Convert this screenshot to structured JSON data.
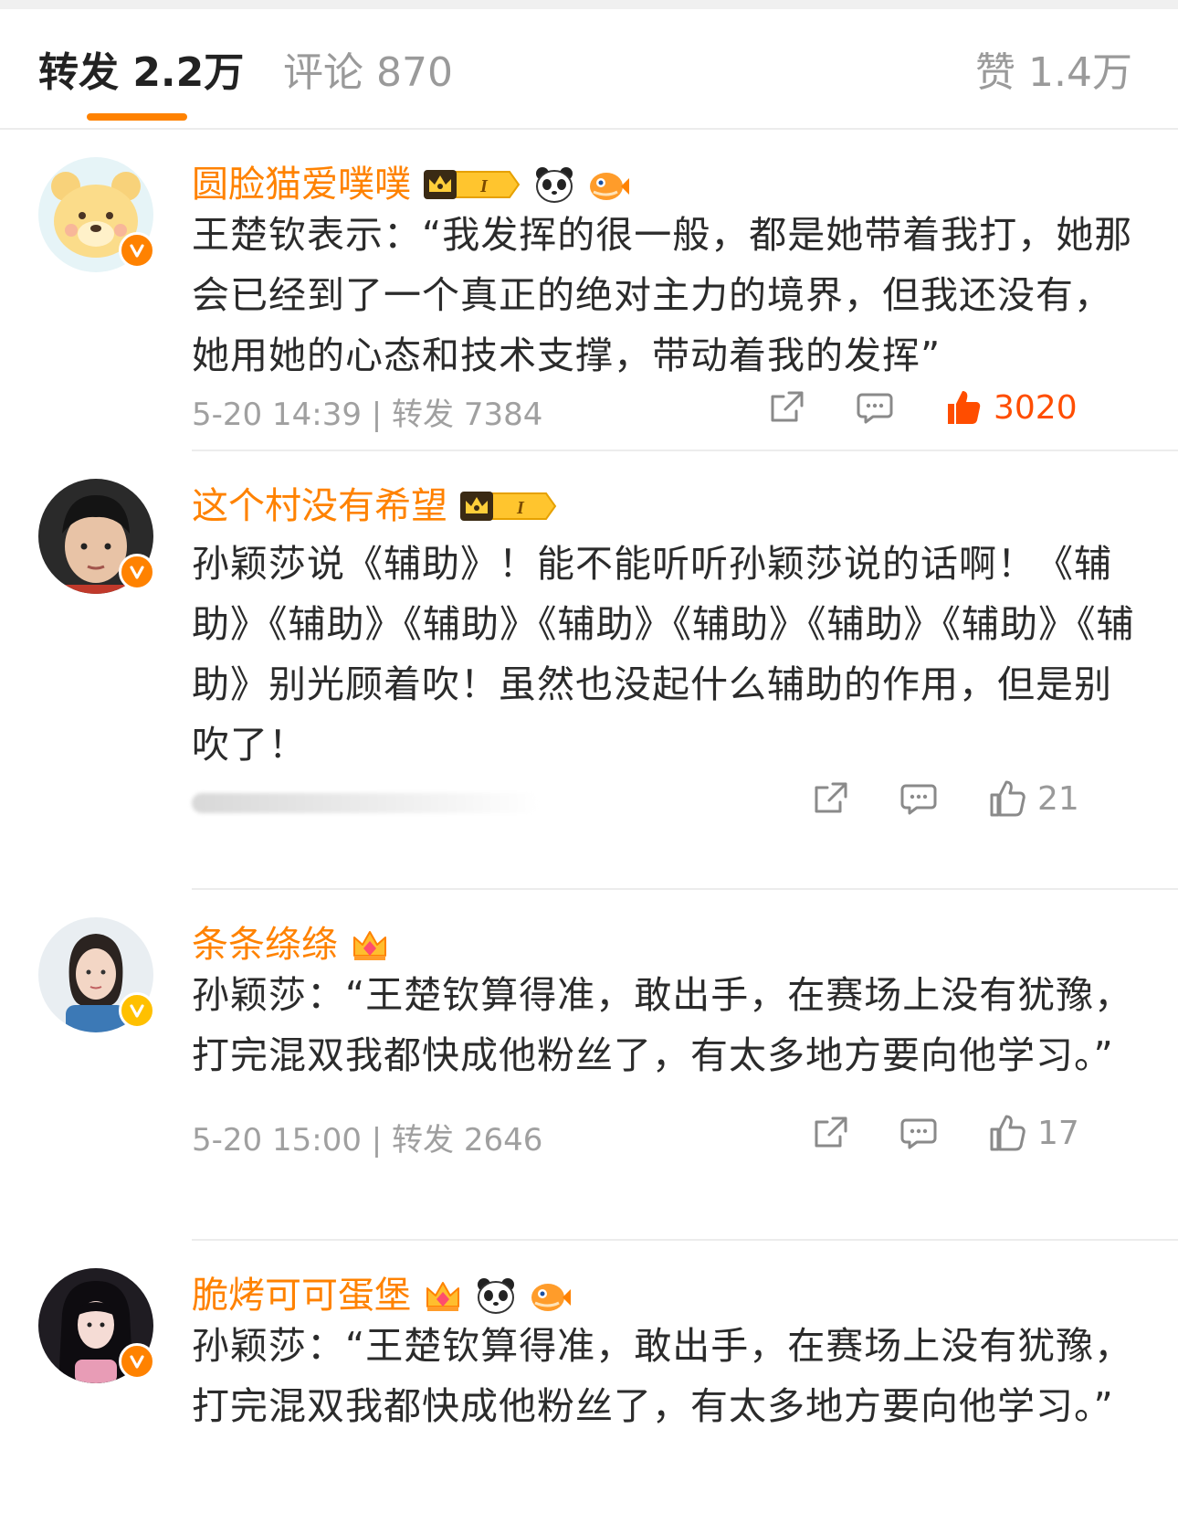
{
  "tabs": {
    "repost_label": "转发 2.2万",
    "comment_label": "评论 870",
    "like_label": "赞 1.4万"
  },
  "colors": {
    "accent": "#ff8200",
    "like_active": "#ff4d00",
    "verified_orange": "#ff8200",
    "verified_gold": "#ffc000",
    "meta_gray": "#a0a0a0"
  },
  "comments": [
    {
      "username": "圆脸猫爱噗噗",
      "badges": [
        "vip-crown-level-badge",
        "panda-icon",
        "pufferfish-icon"
      ],
      "verified": "orange",
      "content": "王楚钦表示：“我发挥的很一般，都是她带着我打，她那会已经到了一个真正的绝对主力的境界，但我还没有，她用她的心态和技术支撑，带动着我的发挥”",
      "meta": "5-20 14:39 | 转发 7384",
      "likes": "3020",
      "liked": true
    },
    {
      "username": "这个村没有希望",
      "badges": [
        "vip-crown-level-badge"
      ],
      "verified": "orange",
      "content": "孙颖莎说《辅助》！能不能听听孙颖莎说的话啊！《辅助》《辅助》《辅助》《辅助》《辅助》《辅助》《辅助》《辅助》别光顾着吹！虽然也没起什么辅助的作用，但是别吹了！",
      "meta": "",
      "likes": "21",
      "liked": false
    },
    {
      "username": "条条绦绦",
      "badges": [
        "gem-crown-icon"
      ],
      "verified": "gold",
      "content": "孙颖莎：“王楚钦算得准，敢出手，在赛场上没有犹豫，打完混双我都快成他粉丝了，有太多地方要向他学习。”",
      "meta": "5-20 15:00 | 转发 2646",
      "likes": "17",
      "liked": false
    },
    {
      "username": "脆烤可可蛋堡",
      "badges": [
        "gem-crown-icon",
        "panda-icon",
        "pufferfish-icon"
      ],
      "verified": "orange",
      "content": "孙颖莎：“王楚钦算得准，敢出手，在赛场上没有犹豫，打完混双我都快成他粉丝了，有太多地方要向他学习。”",
      "meta": "",
      "likes": "",
      "liked": false
    }
  ]
}
